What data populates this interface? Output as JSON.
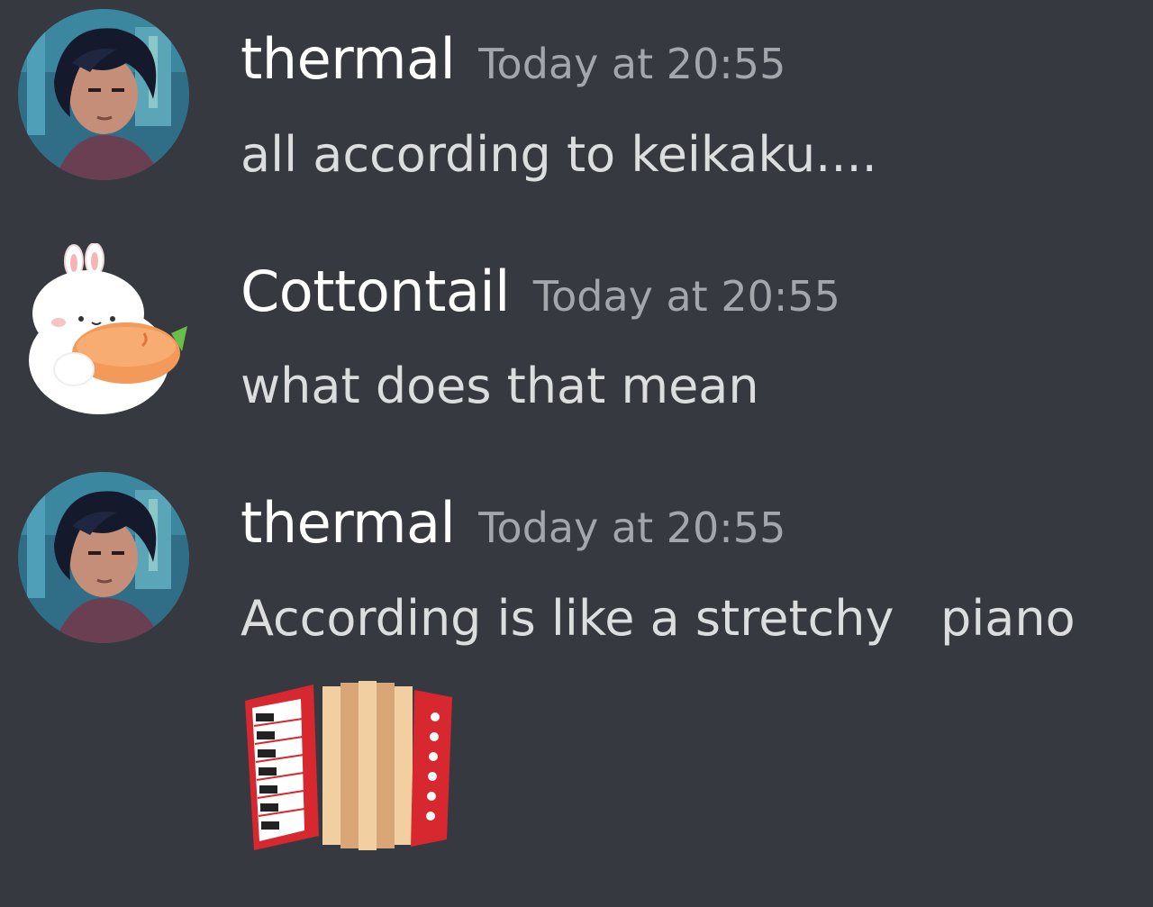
{
  "messages": [
    {
      "username": "thermal",
      "timestamp": "Today at 20:55",
      "text": "all according to keikaku...."
    },
    {
      "username": "Cottontail",
      "timestamp": "Today at 20:55",
      "text": "what does that mean"
    },
    {
      "username": "thermal",
      "timestamp": "Today at 20:55",
      "text": "According is like a stretchy   piano",
      "emoji": "accordion-emoji"
    }
  ],
  "colors": {
    "background": "#36393f",
    "username": "#ffffff",
    "timestamp": "#a3a6aa",
    "message_text": "#dcddde"
  }
}
